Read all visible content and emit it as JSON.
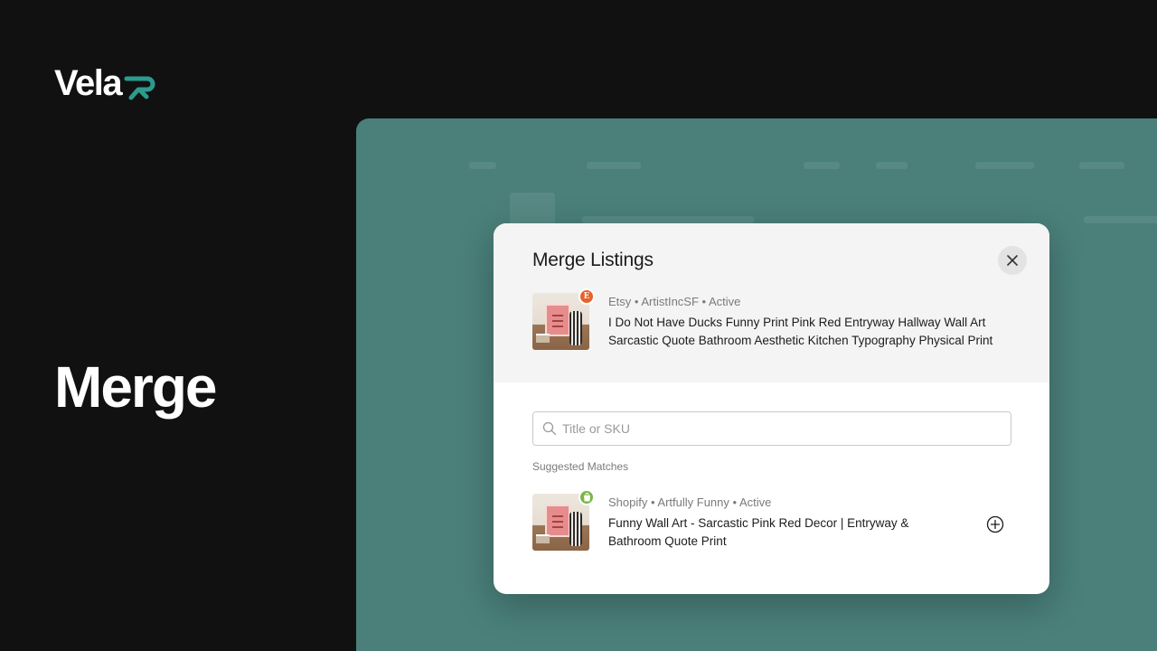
{
  "brand": {
    "name": "Vela",
    "accent": "#2c9b8f"
  },
  "hero": {
    "title": "Merge"
  },
  "modal": {
    "title": "Merge Listings",
    "close_icon": "close-icon",
    "source_listing": {
      "platform_badge": "E",
      "meta": "Etsy • ArtistIncSF • Active",
      "title": "I Do Not Have Ducks Funny Print Pink Red Entryway Hallway Wall Art Sarcastic Quote Bathroom Aesthetic Kitchen Typography Physical Print"
    },
    "search": {
      "placeholder": "Title or SKU",
      "value": ""
    },
    "suggested_label": "Suggested Matches",
    "suggestions": [
      {
        "platform_badge": "shopify-bag-icon",
        "meta": "Shopify • Artfully Funny • Active",
        "title": "Funny Wall Art - Sarcastic Pink Red Decor | Entryway & Bathroom Quote Print",
        "action_icon": "add-circle-icon"
      }
    ]
  },
  "colors": {
    "background": "#111111",
    "app_backdrop": "#4a7f7a",
    "etsy": "#e5632a",
    "shopify": "#7ab648"
  }
}
